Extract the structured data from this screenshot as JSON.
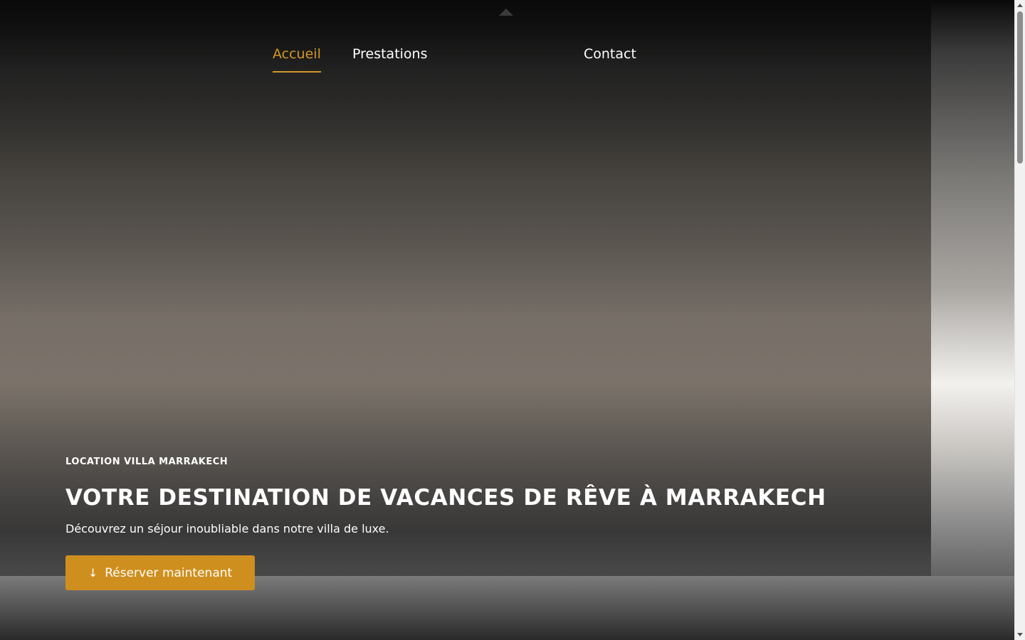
{
  "nav": {
    "items": [
      {
        "label": "Accueil",
        "active": true
      },
      {
        "label": "Prestations",
        "active": false
      },
      {
        "label": "Contact",
        "active": false
      }
    ]
  },
  "hero": {
    "eyebrow": "LOCATION VILLA MARRAKECH",
    "title": "VOTRE DESTINATION DE VACANCES DE RÊVE À MARRAKECH",
    "subtitle": "Découvrez un séjour inoubliable dans notre villa de luxe.",
    "cta_label": "Réserver maintenant",
    "cta_icon": "arrow-down-icon"
  },
  "colors": {
    "accent": "#cf8f1f",
    "active_nav": "#d4962a",
    "text": "#ffffff"
  },
  "scrollbar": {
    "position_fraction": 0.0
  }
}
